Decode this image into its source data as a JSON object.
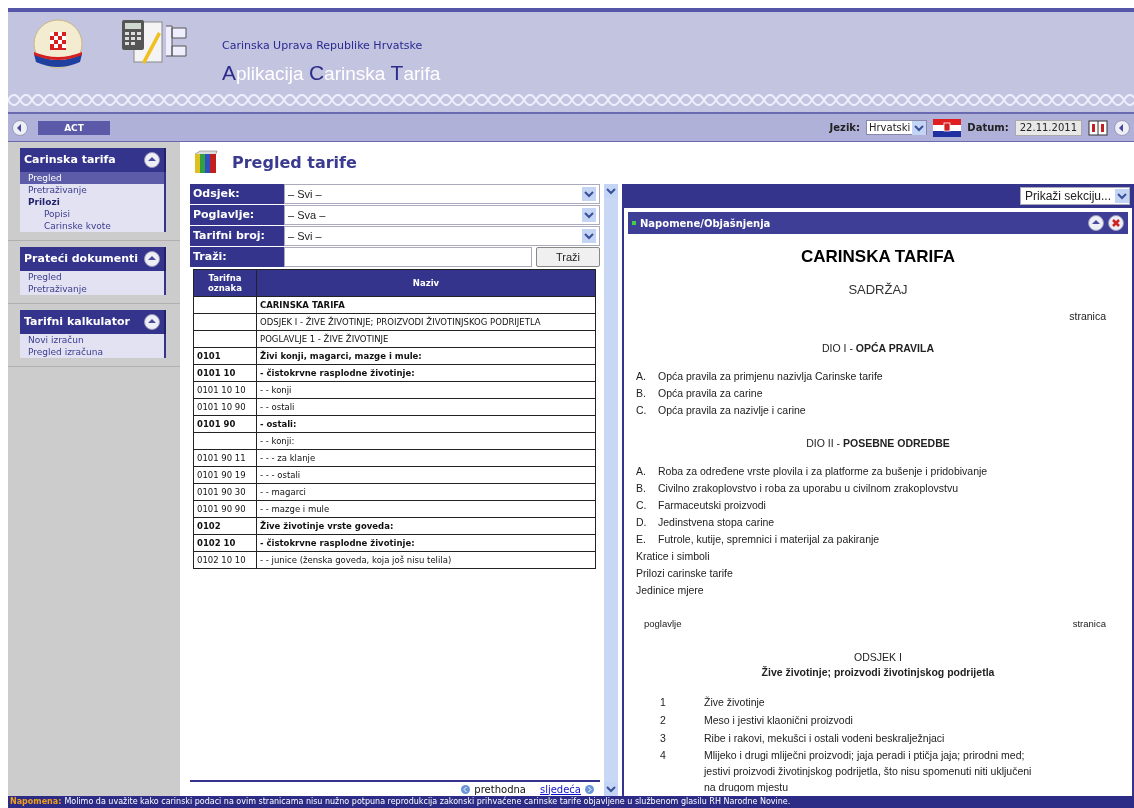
{
  "header": {
    "agency": "Carinska Uprava Republike Hrvatske",
    "app_title": [
      {
        "text": "A",
        "accent": true
      },
      {
        "text": "plikacija ",
        "accent": false
      },
      {
        "text": "C",
        "accent": true
      },
      {
        "text": "arinska ",
        "accent": false
      },
      {
        "text": "T",
        "accent": true
      },
      {
        "text": "arifa",
        "accent": false
      }
    ]
  },
  "toolbar": {
    "button": "ACT",
    "language_label": "Jezik:",
    "language": "Hrvatski",
    "date_label": "Datum:",
    "date": "22.11.2011"
  },
  "sidebar": {
    "groups": [
      {
        "title": "Carinska tarifa",
        "items": [
          {
            "label": "Pregled",
            "selected": true
          },
          {
            "label": "Pretraživanje",
            "selected": false
          },
          {
            "label": "Prilozi",
            "selected": false,
            "children": [
              {
                "label": "Popisi",
                "selected": false
              },
              {
                "label": "Carinske kvote",
                "selected": false
              }
            ]
          }
        ]
      },
      {
        "title": "Prateći dokumenti",
        "items": [
          {
            "label": "Pregled",
            "selected": false
          },
          {
            "label": "Pretraživanje",
            "selected": false
          }
        ]
      },
      {
        "title": "Tarifni kalkulator",
        "items": [
          {
            "label": "Novi izračun",
            "selected": false
          },
          {
            "label": "Pregled izračuna",
            "selected": false
          }
        ]
      }
    ]
  },
  "page_title": "Pregled tarife",
  "filters": [
    {
      "label": "Odsjek:",
      "kind": "select",
      "value": "– Svi –"
    },
    {
      "label": "Poglavlje:",
      "kind": "select",
      "value": "– Sva –"
    },
    {
      "label": "Tarifni broj:",
      "kind": "select",
      "value": "– Svi –"
    },
    {
      "label": "Traži:",
      "kind": "search",
      "button": "Traži"
    }
  ],
  "table": {
    "columns": [
      "Tarifna oznaka",
      "Naziv"
    ],
    "rows": [
      {
        "name": "CARINSKA TARIFA",
        "bold": true
      },
      {
        "name": "ODSJEK I - ŽIVE ŽIVOTINJE; PROIZVODI ŽIVOTINJSKOG PODRIJETLA",
        "bold": false
      },
      {
        "name": "POGLAVLJE 1 - ŽIVE ŽIVOTINJE",
        "bold": false
      },
      {
        "code": "0101",
        "name": "Živi konji, magarci, mazge i mule:",
        "bold": true
      },
      {
        "code": "0101 10",
        "name": "- čistokrvne rasplodne životinje:",
        "bold": true
      },
      {
        "code": "0101 10 10",
        "name": "- - konji",
        "bold": false
      },
      {
        "code": "0101 10 90",
        "name": "- - ostali",
        "bold": false
      },
      {
        "code": "0101 90",
        "name": "- ostali:",
        "bold": true
      },
      {
        "name": "- - konji:",
        "bold": false
      },
      {
        "code": "0101 90 11",
        "name": "- - - za klanje",
        "bold": false
      },
      {
        "code": "0101 90 19",
        "name": "- - - ostali",
        "bold": false
      },
      {
        "code": "0101 90 30",
        "name": "- - magarci",
        "bold": false
      },
      {
        "code": "0101 90 90",
        "name": "- - mazge i mule",
        "bold": false
      },
      {
        "code": "0102",
        "name": "Žive životinje vrste goveda:",
        "bold": true
      },
      {
        "code": "0102 10",
        "name": "- čistokrvne rasplodne životinje:",
        "bold": true
      },
      {
        "code": "0102 10 10",
        "name": "- - junice (ženska goveda, koja još nisu telila)",
        "bold": false
      }
    ]
  },
  "pagination": {
    "previous": "prethodna",
    "next": "sljedeća"
  },
  "panel": {
    "section_select": "Prikaži sekciju...",
    "title": "Napomene/Objašnjenja",
    "document": [
      {
        "kind": "title",
        "text": "CARINSKA TARIFA"
      },
      {
        "kind": "subtitle",
        "text": "SADRŽAJ"
      },
      {
        "kind": "right",
        "text": "stranica"
      },
      {
        "kind": "heading",
        "text": "DIO I - **OPĆA PRAVILA**"
      },
      {
        "kind": "item",
        "marker": "A.",
        "text": "Opća pravila za primjenu nazivlja Carinske tarife"
      },
      {
        "kind": "item",
        "marker": "B.",
        "text": "Opća pravila za carine"
      },
      {
        "kind": "item",
        "marker": "C.",
        "text": "Opća pravila za nazivlje i carine"
      },
      {
        "kind": "heading",
        "text": "DIO II - **POSEBNE ODREDBE**"
      },
      {
        "kind": "item",
        "marker": "A.",
        "text": "Roba za određene vrste plovila i za platforme za bušenje i pridobivanje"
      },
      {
        "kind": "item",
        "marker": "B.",
        "text": "Civilno zrakoplovstvo i roba za uporabu u civilnom zrakoplovstvu"
      },
      {
        "kind": "item",
        "marker": "C.",
        "text": "Farmaceutski proizvodi"
      },
      {
        "kind": "item",
        "marker": "D.",
        "text": "Jedinstvena stopa carine"
      },
      {
        "kind": "item",
        "marker": "E.",
        "text": "Futrole, kutije, spremnici i materijal za pakiranje"
      },
      {
        "kind": "line",
        "text": "Kratice i simboli"
      },
      {
        "kind": "line",
        "text": "Prilozi carinske tarife"
      },
      {
        "kind": "line",
        "text": "Jedinice mjere"
      },
      {
        "kind": "columns",
        "left": "poglavlje",
        "right": "stranica"
      },
      {
        "kind": "section",
        "text": "ODSJEK I"
      },
      {
        "kind": "section_bold",
        "text": "Žive životinje; proizvodi životinjskog podrijetla"
      },
      {
        "kind": "chapter",
        "marker": "1",
        "text": "Žive životinje"
      },
      {
        "kind": "chapter",
        "marker": "2",
        "text": "Meso i jestivi klaonični proizvodi"
      },
      {
        "kind": "chapter",
        "marker": "3",
        "text": "Ribe i rakovi, mekušci i ostali vodeni beskralježnjaci"
      },
      {
        "kind": "chapter",
        "marker": "4",
        "text": "Mlijeko i drugi mliječni proizvodi; jaja peradi i ptičja jaja; prirodni med; jestivi proizvodi životinjskog podrijetla, što nisu spomenuti niti uključeni na drugom mjestu"
      }
    ]
  },
  "footer": {
    "label": "Napomena:",
    "text": "Molimo da uvažite kako carinski podaci na ovim stranicama nisu nužno potpuna reprodukcija zakonski prihvaćene carinske tarife objavljene u službenom glasilu RH Narodne Novine."
  }
}
